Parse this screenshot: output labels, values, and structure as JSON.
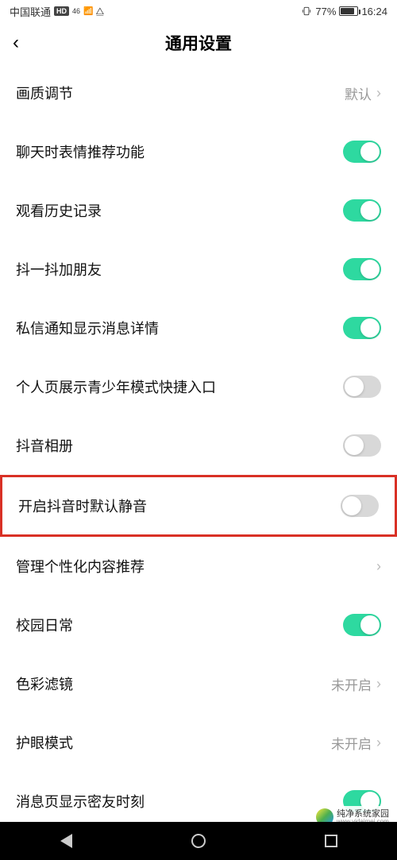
{
  "status": {
    "carrier": "中国联通",
    "hd": "HD",
    "net": "46",
    "battery_pct": "77%",
    "time": "16:24"
  },
  "header": {
    "title": "通用设置"
  },
  "rows": {
    "quality": {
      "label": "画质调节",
      "value": "默认"
    },
    "emoji": {
      "label": "聊天时表情推荐功能"
    },
    "history": {
      "label": "观看历史记录"
    },
    "shake": {
      "label": "抖一抖加朋友"
    },
    "dm_detail": {
      "label": "私信通知显示消息详情"
    },
    "teen_entry": {
      "label": "个人页展示青少年模式快捷入口"
    },
    "album": {
      "label": "抖音相册"
    },
    "default_mute": {
      "label": "开启抖音时默认静音"
    },
    "personalized": {
      "label": "管理个性化内容推荐"
    },
    "campus": {
      "label": "校园日常"
    },
    "color_filter": {
      "label": "色彩滤镜",
      "value": "未开启"
    },
    "eye_care": {
      "label": "护眼模式",
      "value": "未开启"
    },
    "close_friend": {
      "label": "消息页显示密友时刻"
    }
  },
  "watermark": {
    "title": "纯净系统家园",
    "url": "www.yidaimei.com"
  }
}
